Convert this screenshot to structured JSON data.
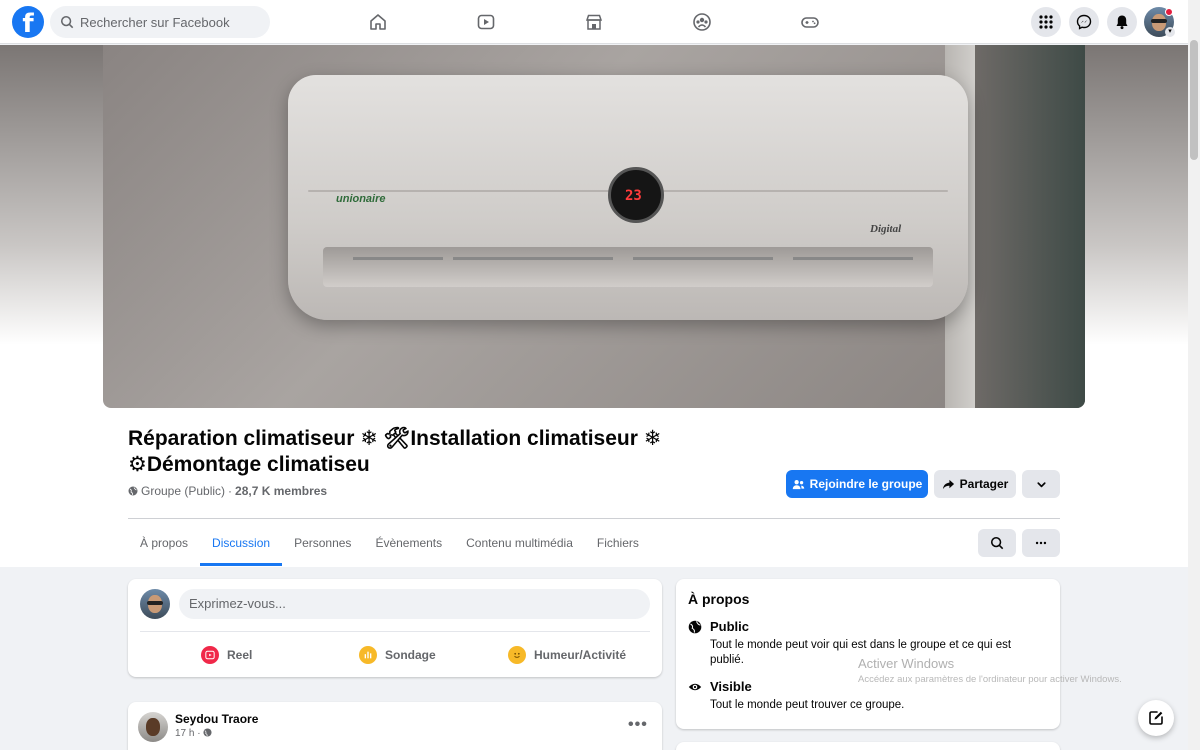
{
  "topbar": {
    "logo": "f",
    "search_placeholder": "Rechercher sur Facebook",
    "nav_icons": [
      "home-icon",
      "video-icon",
      "marketplace-icon",
      "groups-icon",
      "gaming-icon"
    ],
    "right_icons": [
      "menu-grid-icon",
      "messenger-icon",
      "notifications-icon"
    ]
  },
  "cover": {
    "display_value": "23",
    "brand": "unionaire",
    "label": "Digital"
  },
  "group": {
    "title": "Réparation climatiseur ❄ 🛠Installation climatiseur ❄ ⚙Démontage climatiseu",
    "privacy": "Groupe (Public)",
    "separator": "·",
    "members": "28,7 K membres",
    "join_label": "Rejoindre le groupe",
    "share_label": "Partager"
  },
  "tabs": [
    {
      "label": "À propos"
    },
    {
      "label": "Discussion"
    },
    {
      "label": "Personnes"
    },
    {
      "label": "Évènements"
    },
    {
      "label": "Contenu multimédia"
    },
    {
      "label": "Fichiers"
    }
  ],
  "composer": {
    "placeholder": "Exprimez-vous...",
    "actions": [
      {
        "label": "Reel",
        "color": "#f02849"
      },
      {
        "label": "Sondage",
        "color": "#f7b928"
      },
      {
        "label": "Humeur/Activité",
        "color": "#f7b928"
      }
    ]
  },
  "about": {
    "heading": "À propos",
    "public_title": "Public",
    "public_desc": "Tout le monde peut voir qui est dans le groupe et ce qui est publié.",
    "visible_title": "Visible",
    "visible_desc": "Tout le monde peut trouver ce groupe."
  },
  "post": {
    "author": "Seydou Traore",
    "time": "17 h ·"
  },
  "watermark": {
    "title": "Activer Windows",
    "desc": "Accédez aux paramètres de l'ordinateur pour activer Windows."
  },
  "colors": {
    "accent": "#1877f2",
    "background": "#f0f2f5"
  }
}
